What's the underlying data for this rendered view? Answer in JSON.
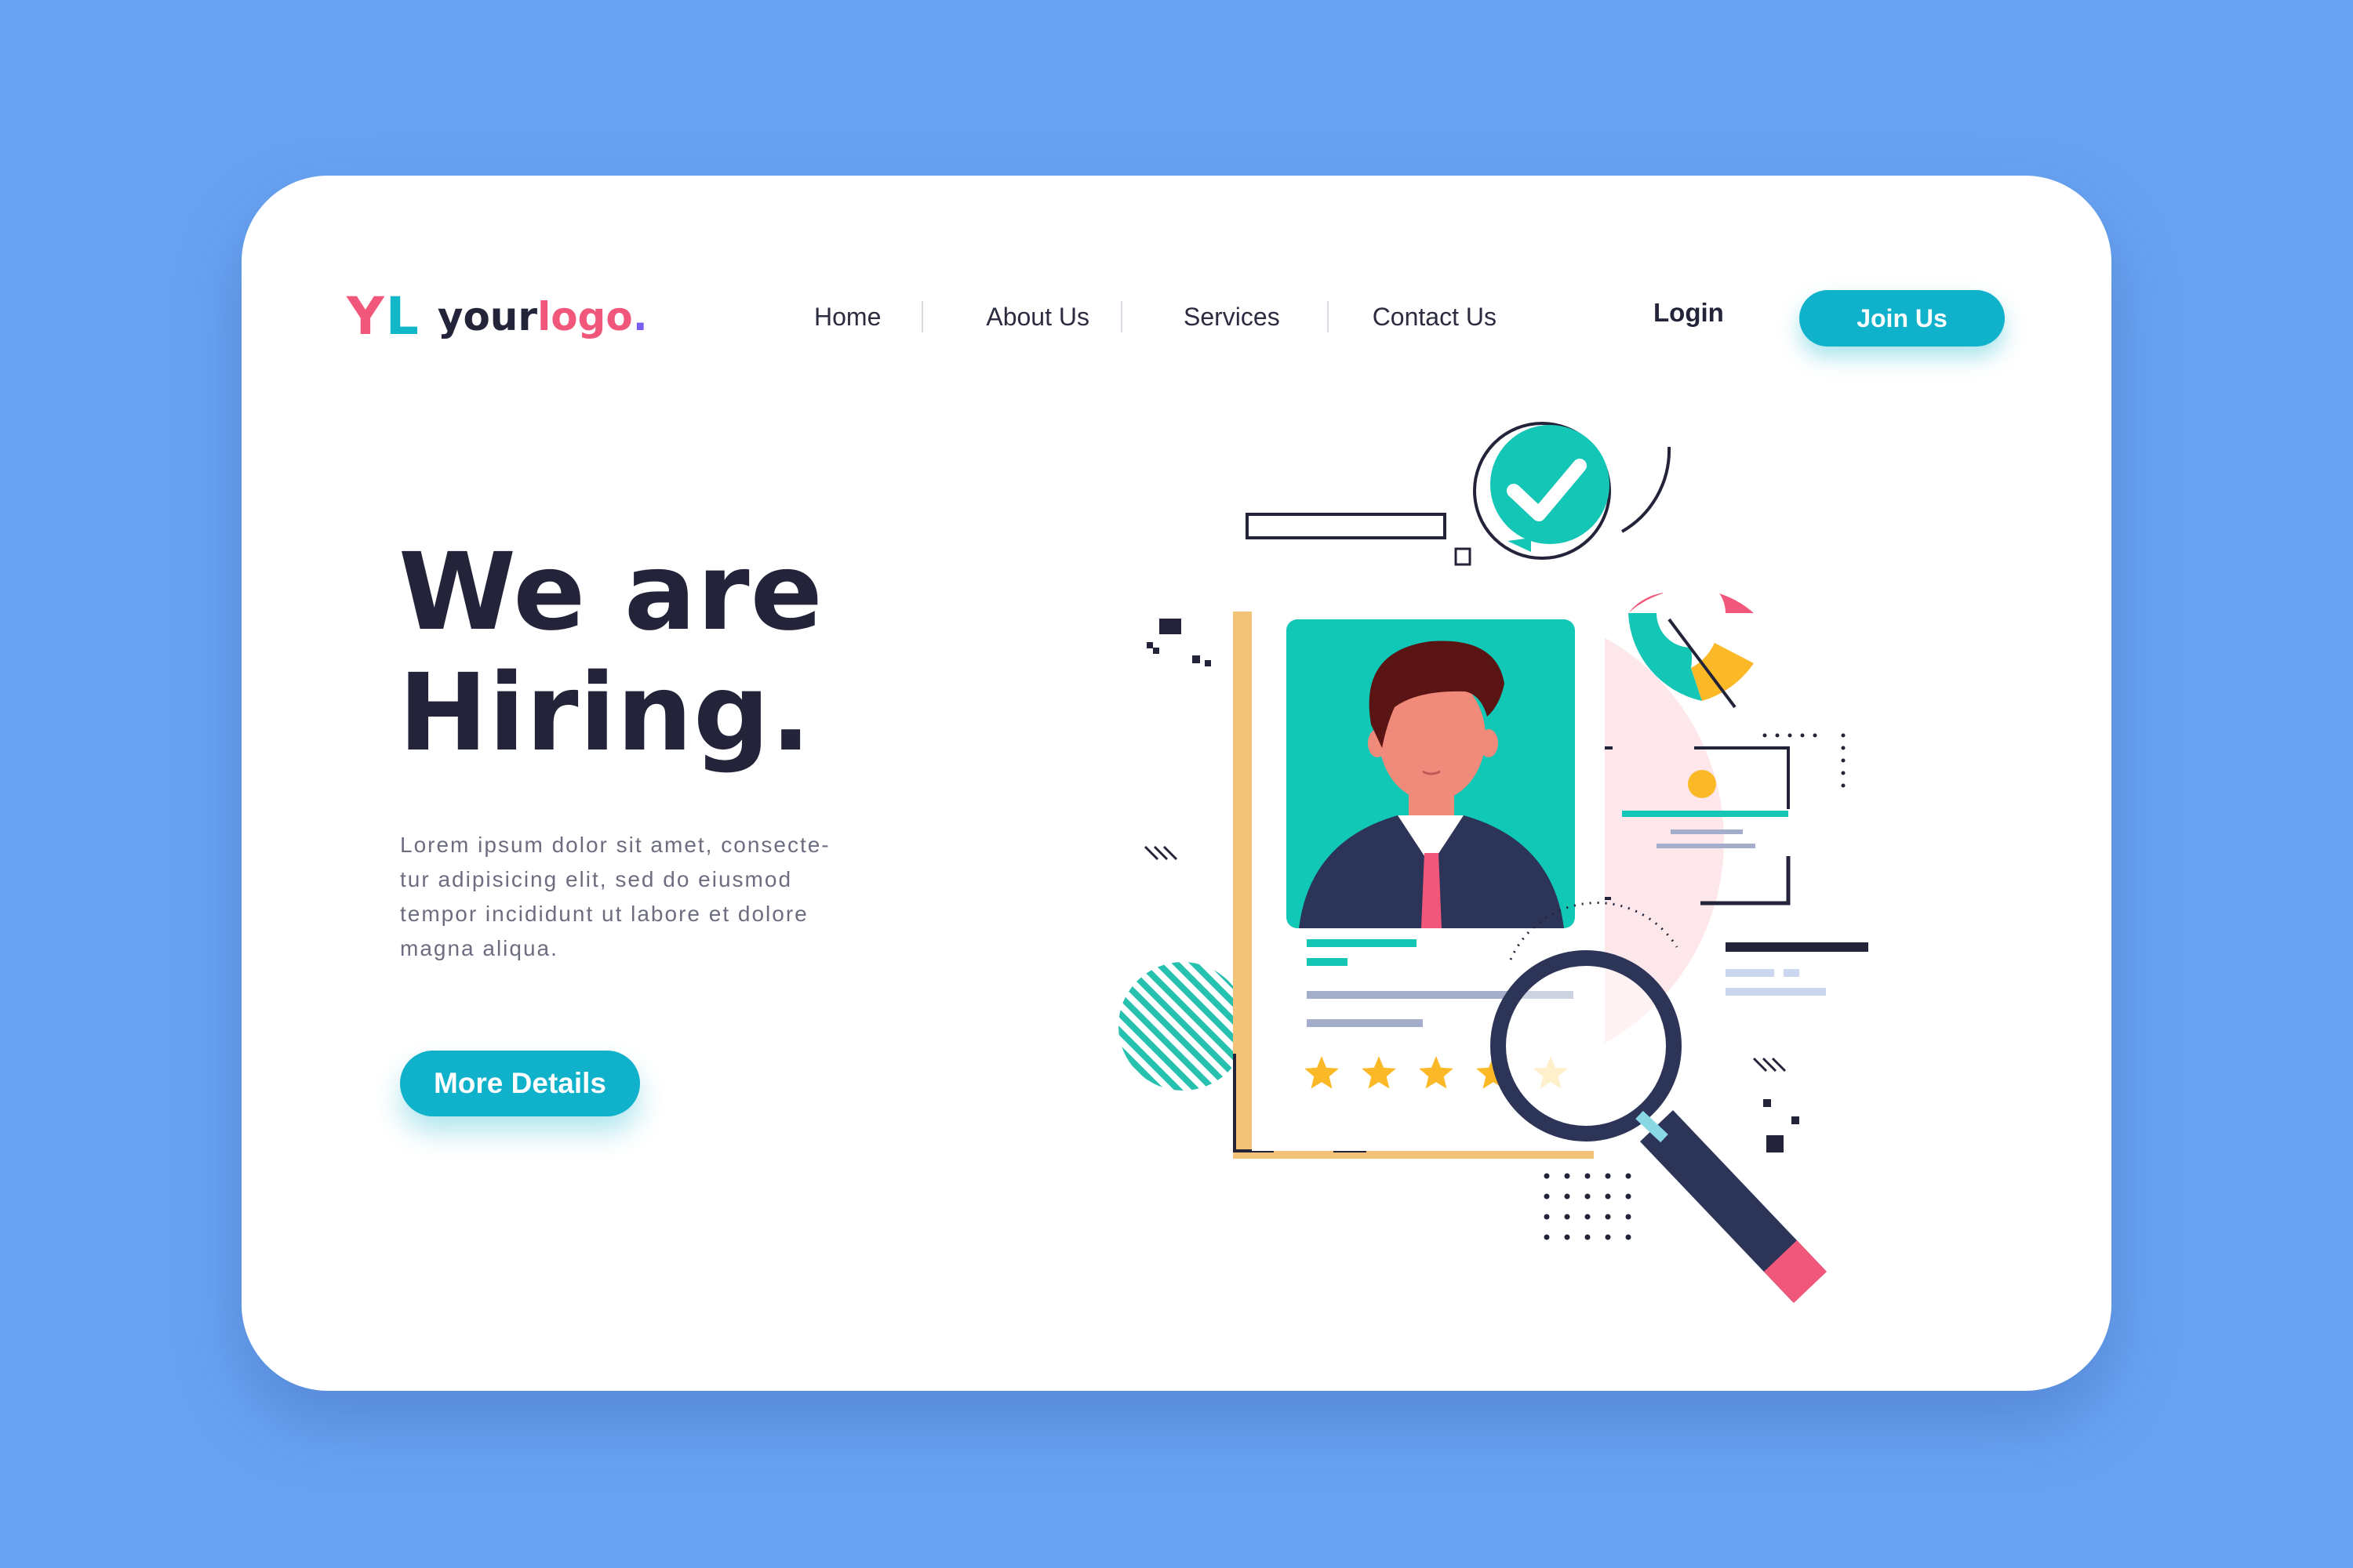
{
  "logo": {
    "mark_y": "Y",
    "mark_l": "L",
    "text_main": "your",
    "text_accent": "logo",
    "text_dot": "."
  },
  "nav": {
    "items": [
      "Home",
      "About Us",
      "Services",
      "Contact Us"
    ]
  },
  "header": {
    "login_label": "Login",
    "join_label": "Join Us"
  },
  "hero": {
    "title_line1": "We are",
    "title_line2": "Hiring.",
    "body_lines": [
      "Lorem ipsum dolor sit amet, consecte-",
      "tur adipisicing elit, sed do eiusmod",
      "tempor incididunt ut labore et dolore",
      "magna aliqua."
    ],
    "cta_label": "More Details"
  },
  "illustration": {
    "rating": {
      "filled_stars": 4,
      "total_stars": 5
    }
  },
  "colors": {
    "background": "#68a3f2",
    "accent_teal": "#0fb1cb",
    "accent_pink": "#f0577a",
    "dark_navy": "#23243a",
    "star_gold": "#fbb928"
  }
}
